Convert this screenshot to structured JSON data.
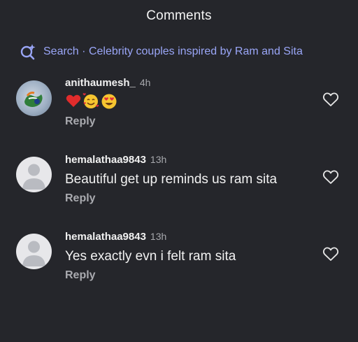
{
  "header": {
    "title": "Comments"
  },
  "search": {
    "label": "Search",
    "separator": "·",
    "query": "Celebrity couples inspired by Ram and Sita"
  },
  "comments": [
    {
      "username": "anithaumesh_",
      "time": "4h",
      "text": "",
      "emojis": [
        "red-heart",
        "smiling-face-with-hearts",
        "heart-eyes"
      ],
      "reply_label": "Reply",
      "avatar": "profile-photo"
    },
    {
      "username": "hemalathaa9843",
      "time": "13h",
      "text": "Beautiful get up reminds us ram sita",
      "reply_label": "Reply",
      "avatar": "default-avatar"
    },
    {
      "username": "hemalathaa9843",
      "time": "13h",
      "text": "Yes exactly evn i felt ram sita",
      "reply_label": "Reply",
      "avatar": "default-avatar"
    }
  ],
  "colors": {
    "background": "#25262b",
    "accent": "#9aa6f7",
    "muted": "#a7a8ad"
  }
}
